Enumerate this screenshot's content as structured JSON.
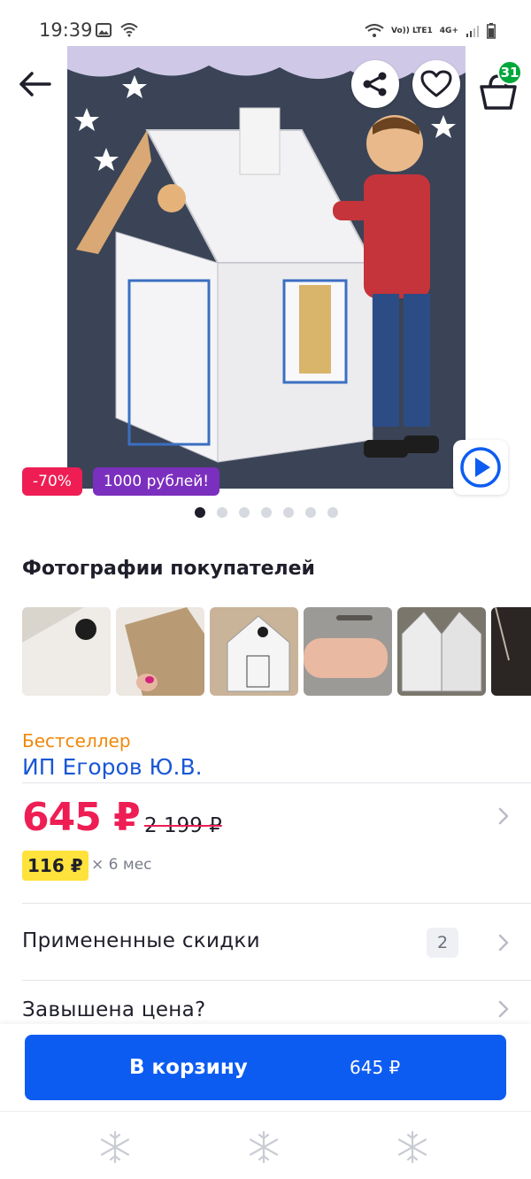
{
  "status_bar": {
    "time": "19:39",
    "left_icons": [
      "image-icon",
      "wifi-icon"
    ],
    "right_icons": [
      "wifi-icon",
      "volte-icon",
      "signal-icon",
      "battery-icon"
    ],
    "volte_text": "Vo)) LTE1",
    "network_text": "4G+"
  },
  "header": {
    "back_icon": "arrow-left-icon",
    "share_icon": "share-icon",
    "favorite_icon": "heart-icon",
    "cart_icon": "basket-icon",
    "cart_count": "31"
  },
  "gallery": {
    "badges": [
      {
        "label": "-70%",
        "color": "#ee1e55"
      },
      {
        "label": "1000 рублей!",
        "color": "#7b2fbe"
      }
    ],
    "play_icon": "play-icon",
    "dots_total": 7,
    "active_dot": 0
  },
  "customer_photos": {
    "title": "Фотографии покупателей",
    "count_visible": 6
  },
  "product": {
    "bestseller_label": "Бестселлер",
    "seller": "ИП Егоров Ю.В.",
    "price_current": "645 ₽",
    "price_old": "2 199 ₽",
    "installment_amount": "116 ₽",
    "installment_term": "× 6 мес"
  },
  "rows": [
    {
      "label": "Примененные скидки",
      "count": "2"
    },
    {
      "label": "Завышена цена?"
    }
  ],
  "cta": {
    "label": "В корзину",
    "price": "645 ₽"
  },
  "bottom_nav": {
    "icons": [
      "snowflake-icon",
      "snowflake-icon",
      "snowflake-icon"
    ]
  },
  "colors": {
    "accent": "#0d5cf2",
    "price_red": "#ee1e55",
    "seller_blue": "#1a57d6",
    "bestseller_orange": "#f0880a",
    "installment_yellow": "#ffe23b",
    "badge_green": "#00a83b"
  }
}
